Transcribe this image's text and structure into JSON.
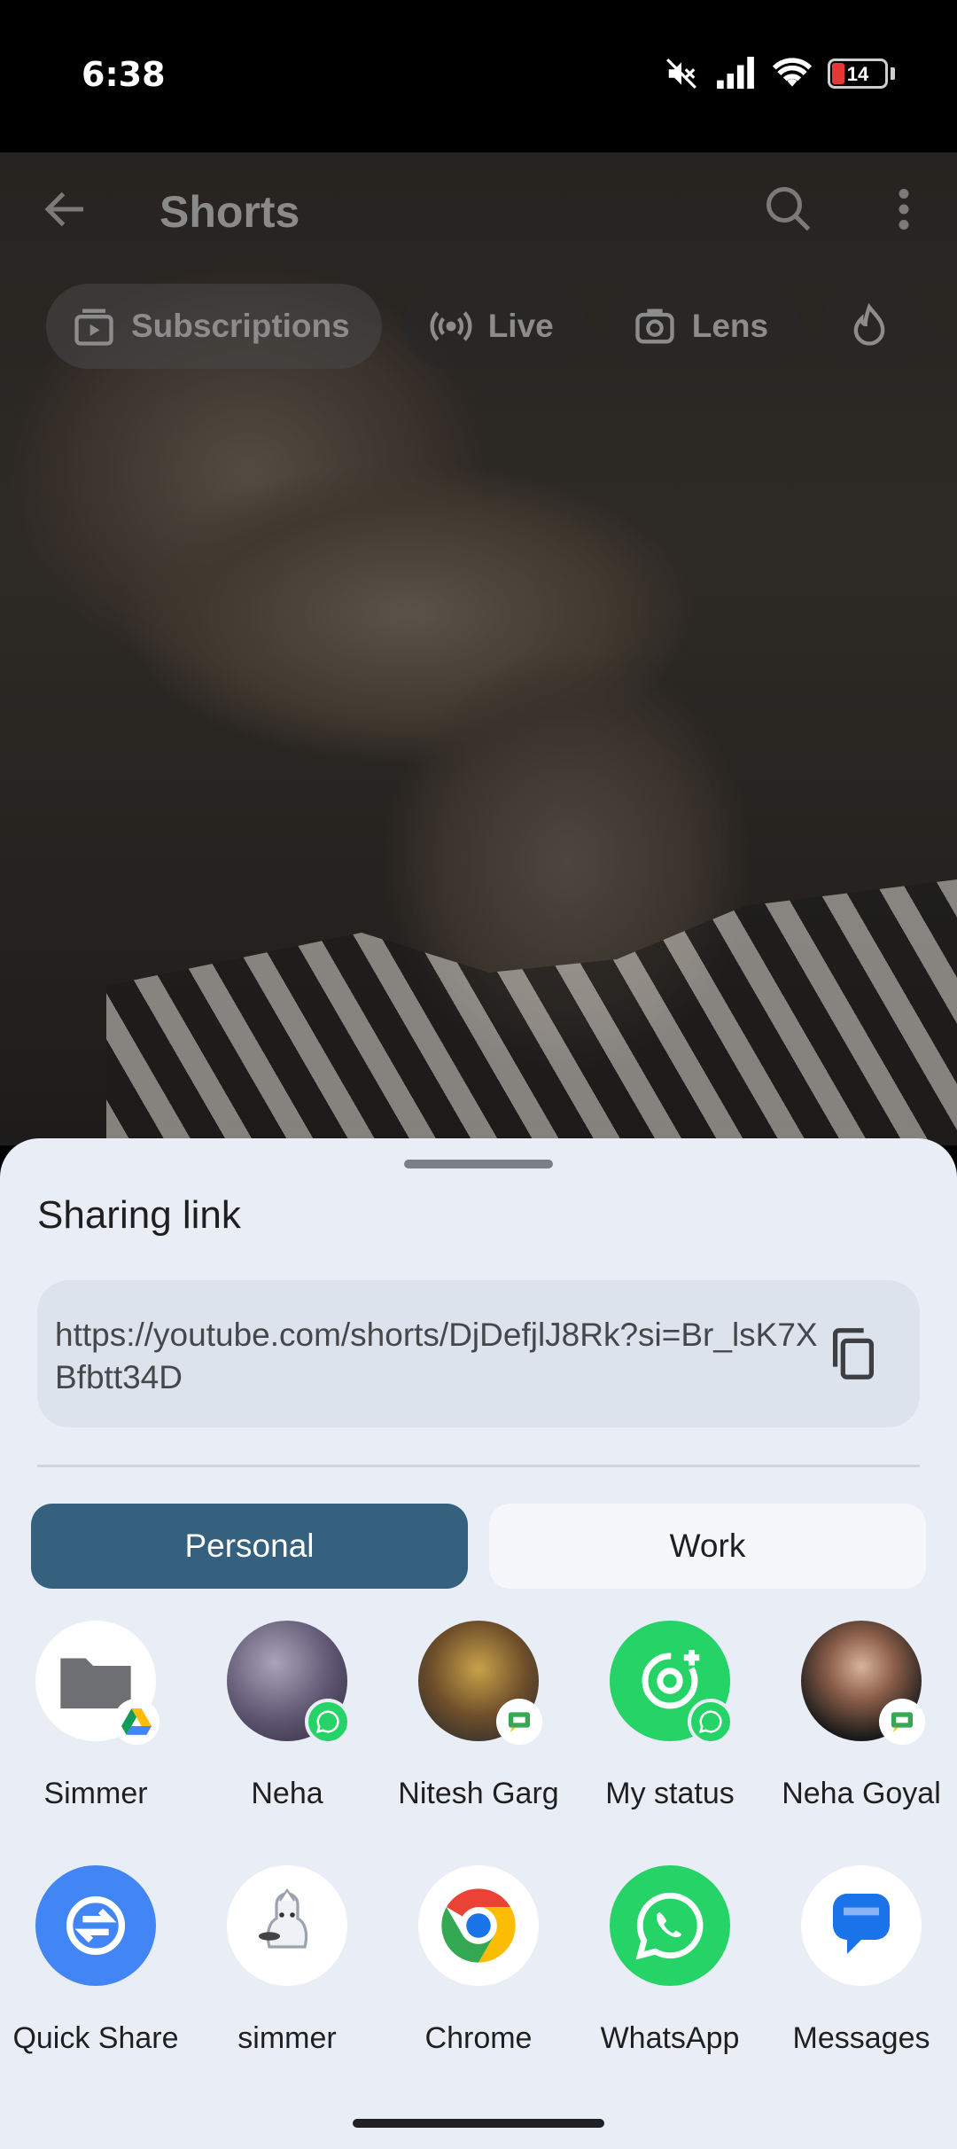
{
  "status_bar": {
    "time": "6:38",
    "battery": "14"
  },
  "app": {
    "title": "Shorts",
    "chips": [
      "Subscriptions",
      "Live",
      "Lens"
    ]
  },
  "share_sheet": {
    "title": "Sharing link",
    "link": "https://youtube.com/shorts/DjDefjlJ8Rk?si=Br_lsK7XBfbtt34D",
    "tabs": {
      "personal": "Personal",
      "work": "Work"
    },
    "direct_share": [
      {
        "label": "Simmer",
        "badge": "google-drive"
      },
      {
        "label": "Neha",
        "badge": "whatsapp"
      },
      {
        "label": "Nitesh Garg",
        "badge": "google-messages"
      },
      {
        "label": "My status",
        "badge": "whatsapp"
      },
      {
        "label": "Neha Goyal",
        "badge": "google-messages"
      }
    ],
    "apps": [
      {
        "label": "Quick Share"
      },
      {
        "label": "simmer"
      },
      {
        "label": "Chrome"
      },
      {
        "label": "WhatsApp"
      },
      {
        "label": "Messages"
      }
    ]
  },
  "colors": {
    "accent": "#35607e",
    "sheet_bg": "#e9eef6",
    "whatsapp": "#25d366",
    "quick_share": "#4285f4"
  }
}
